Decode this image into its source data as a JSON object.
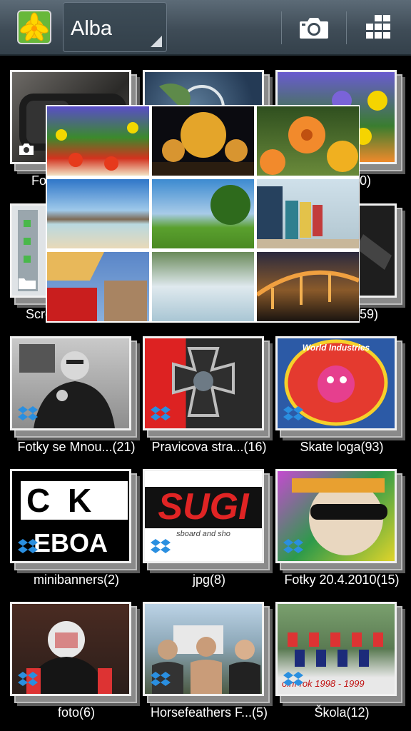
{
  "header": {
    "title": "Alba",
    "app_icon": "lily-flower-icon",
    "actions": [
      {
        "name": "camera-icon"
      },
      {
        "name": "grid-view-icon"
      }
    ]
  },
  "albums": [
    {
      "label": "Fo",
      "count_suffix": "",
      "badge": "camera-icon"
    },
    {
      "label": "",
      "count_suffix": "",
      "badge": ""
    },
    {
      "label": "0)",
      "count_suffix": "",
      "badge": ""
    },
    {
      "label": "Scre",
      "count_suffix": "",
      "badge": "folder-icon"
    },
    {
      "label": "",
      "count_suffix": "",
      "badge": ""
    },
    {
      "label": "59)",
      "count_suffix": "",
      "badge": ""
    },
    {
      "label": "Fotky se Mnou...(21)",
      "badge": "dropbox-icon"
    },
    {
      "label": "Pravicova stra...(16)",
      "badge": "dropbox-icon"
    },
    {
      "label": "Skate loga(93)",
      "badge": "dropbox-icon"
    },
    {
      "label": "minibanners(2)",
      "badge": "dropbox-icon"
    },
    {
      "label": "jpg(8)",
      "badge": "dropbox-icon"
    },
    {
      "label": "Fotky 20.4.2010(15)",
      "badge": "dropbox-icon"
    },
    {
      "label": "foto(6)",
      "badge": "dropbox-icon"
    },
    {
      "label": "Horsefeathers F...(5)",
      "badge": "dropbox-icon"
    },
    {
      "label": "Škola(12)",
      "badge": "dropbox-icon"
    }
  ],
  "thumb_texts": {
    "minibanners_top": "C K",
    "minibanners_bottom": "EBOA",
    "jpg_banner": "SUGI",
    "jpg_sub": "sboard and sho",
    "skola_caption": "olní rok 1998 - 1999",
    "skate_logo": "World Industries"
  },
  "collage": {
    "cells": [
      {
        "name": "tulips"
      },
      {
        "name": "night-buildings"
      },
      {
        "name": "orange-flowers"
      },
      {
        "name": "salt-lake"
      },
      {
        "name": "green-hill"
      },
      {
        "name": "beach-huts"
      },
      {
        "name": "umbrella-street"
      },
      {
        "name": "waterfall"
      },
      {
        "name": "night-bridge"
      }
    ]
  },
  "colors": {
    "actionbar_top": "#5c6b77",
    "actionbar_bottom": "#34414b",
    "dropbox_blue": "#2a8fe0",
    "label_text": "#ffffff"
  }
}
